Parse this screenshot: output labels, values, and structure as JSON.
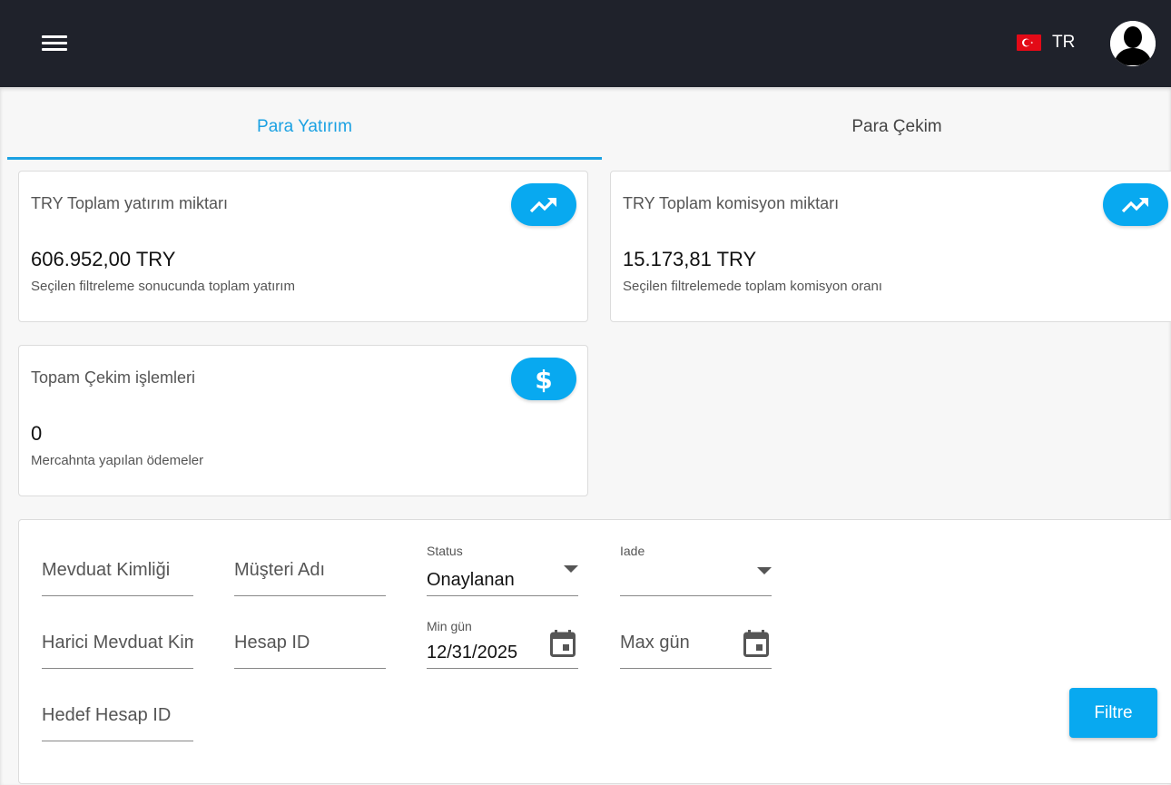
{
  "header": {
    "menu_icon": "menu-icon",
    "flag_icon": "turkey-flag-icon",
    "flag_color": "#e30a17",
    "language": "TR",
    "avatar_icon": "user-avatar-icon"
  },
  "tabs": [
    {
      "label": "Para Yatırım",
      "active": true
    },
    {
      "label": "Para Çekim",
      "active": false
    }
  ],
  "accent_color": "#08a9f0",
  "cards": [
    {
      "title": "TRY Toplam yatırım miktarı",
      "value": "606.952,00 TRY",
      "subtitle": "Seçilen filtreleme sonucunda toplam yatırım",
      "icon": "trending-up-icon"
    },
    {
      "title": "TRY Toplam komisyon miktarı",
      "value": "15.173,81 TRY",
      "subtitle": "Seçilen filtrelemede toplam komisyon oranı",
      "icon": "trending-up-icon"
    },
    {
      "title": "Topam Çekim işlemleri",
      "value": "0",
      "subtitle": "Mercahnta yapılan ödemeler",
      "icon": "dollar-icon"
    }
  ],
  "filters": {
    "deposit_id": {
      "placeholder": "Mevduat Kimliği",
      "value": ""
    },
    "customer_name": {
      "placeholder": "Müşteri Adı",
      "value": ""
    },
    "status": {
      "label": "Status",
      "value": "Onaylanan"
    },
    "refund": {
      "label": "Iade",
      "value": ""
    },
    "external_deposit_id": {
      "placeholder": "Harici Mevduat Kimliği",
      "value": ""
    },
    "account_id": {
      "placeholder": "Hesap ID",
      "value": ""
    },
    "min_day": {
      "label": "Min gün",
      "value": "12/31/2025"
    },
    "max_day": {
      "placeholder": "Max gün",
      "value": ""
    },
    "target_account_id": {
      "placeholder": "Hedef Hesap ID",
      "value": ""
    }
  },
  "filter_button": "Filtre"
}
